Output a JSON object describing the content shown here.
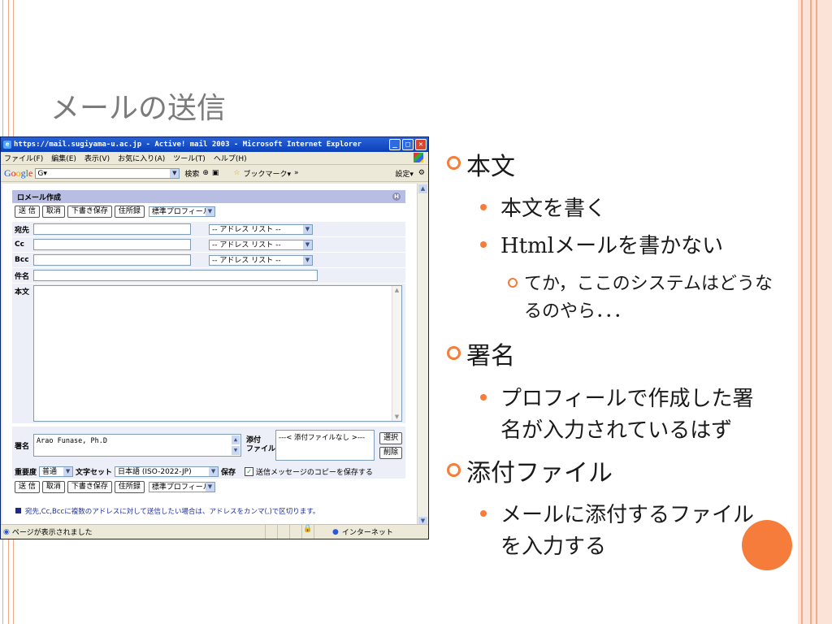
{
  "slide": {
    "title": "メールの送信",
    "bullets": [
      {
        "level": 1,
        "text": "本文"
      },
      {
        "level": 2,
        "text": "本文を書く"
      },
      {
        "level": 2,
        "text": "Htmlメールを書かない"
      },
      {
        "level": 3,
        "lines": [
          "てか，ここのシステムはどうな",
          "るのやら．．．"
        ]
      },
      {
        "level": 1,
        "text": "署名"
      },
      {
        "level": 2,
        "lines": [
          "プロフィールで作成した署",
          "名が入力されているはず"
        ]
      },
      {
        "level": 1,
        "text": "添付ファイル"
      },
      {
        "level": 2,
        "lines": [
          "メールに添付するファイル",
          "を入力する"
        ]
      }
    ],
    "accent_color": "#f57c3a",
    "line_color": "#f2a98a"
  },
  "browser": {
    "title": "https://mail.sugiyama-u.ac.jp - Active! mail 2003 - Microsoft Internet Explorer",
    "menu": [
      "ファイル(F)",
      "編集(E)",
      "表示(V)",
      "お気に入り(A)",
      "ツール(T)",
      "ヘルプ(H)"
    ],
    "google": {
      "logo": [
        "G",
        "o",
        "o",
        "g",
        "l",
        "e"
      ],
      "input_value": "G▾",
      "search_label": "検索",
      "bookmarks_label": "ブックマーク▾",
      "more": "»",
      "settings_label": "設定▾"
    },
    "status": {
      "left": "ページが表示されました",
      "zone": "インターネット"
    }
  },
  "compose": {
    "header": "ロメール作成",
    "help": "H",
    "buttons": {
      "send": "送 信",
      "cancel": "取消",
      "draft": "下書き保存",
      "address": "住所録"
    },
    "profile": "標準プロフィール",
    "labels": {
      "to": "宛先",
      "cc": "Cc",
      "bcc": "Bcc",
      "subject": "件名",
      "body": "本文",
      "signature": "署名",
      "attach": [
        "添付",
        "ファイル"
      ]
    },
    "address_list": "-- アドレス リスト --",
    "signature_text": "Arao Funase, Ph.D",
    "attach_placeholder": "---< 添付ファイルなし >---",
    "attach_buttons": {
      "select": "選択",
      "delete": "削除"
    },
    "options": {
      "priority_label": "重要度",
      "priority_value": "普通",
      "charset_label": "文字セット",
      "charset_value": "日本語 (ISO-2022-JP)",
      "save_label": "保存",
      "save_copy": "送信メッセージのコピーを保存する"
    },
    "note": "宛先,Cc,Bccに複数のアドレスに対して送信したい場合は、アドレスをカンマ(,)で区切ります。"
  }
}
